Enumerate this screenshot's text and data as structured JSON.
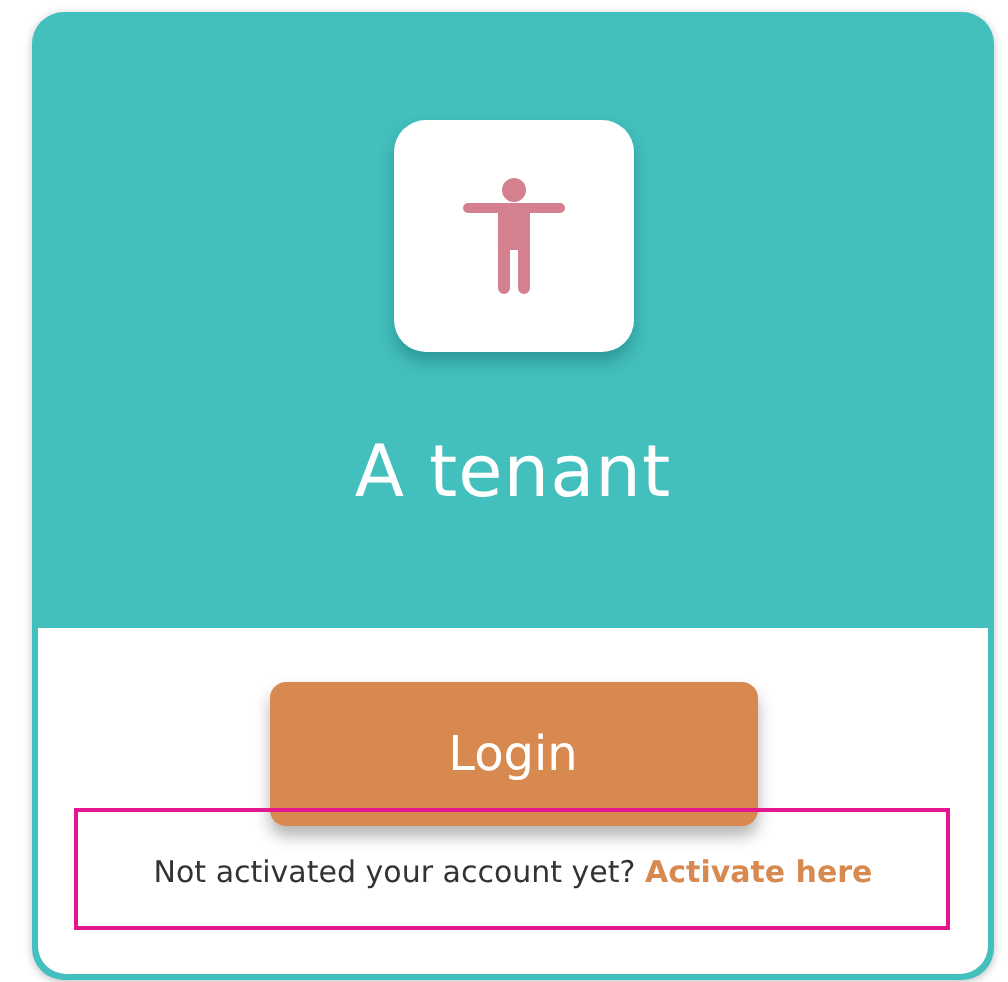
{
  "card": {
    "title": "A tenant",
    "button": "Login",
    "prompt": "Not activated your account yet?",
    "link": "Activate here",
    "highlighted": true
  }
}
